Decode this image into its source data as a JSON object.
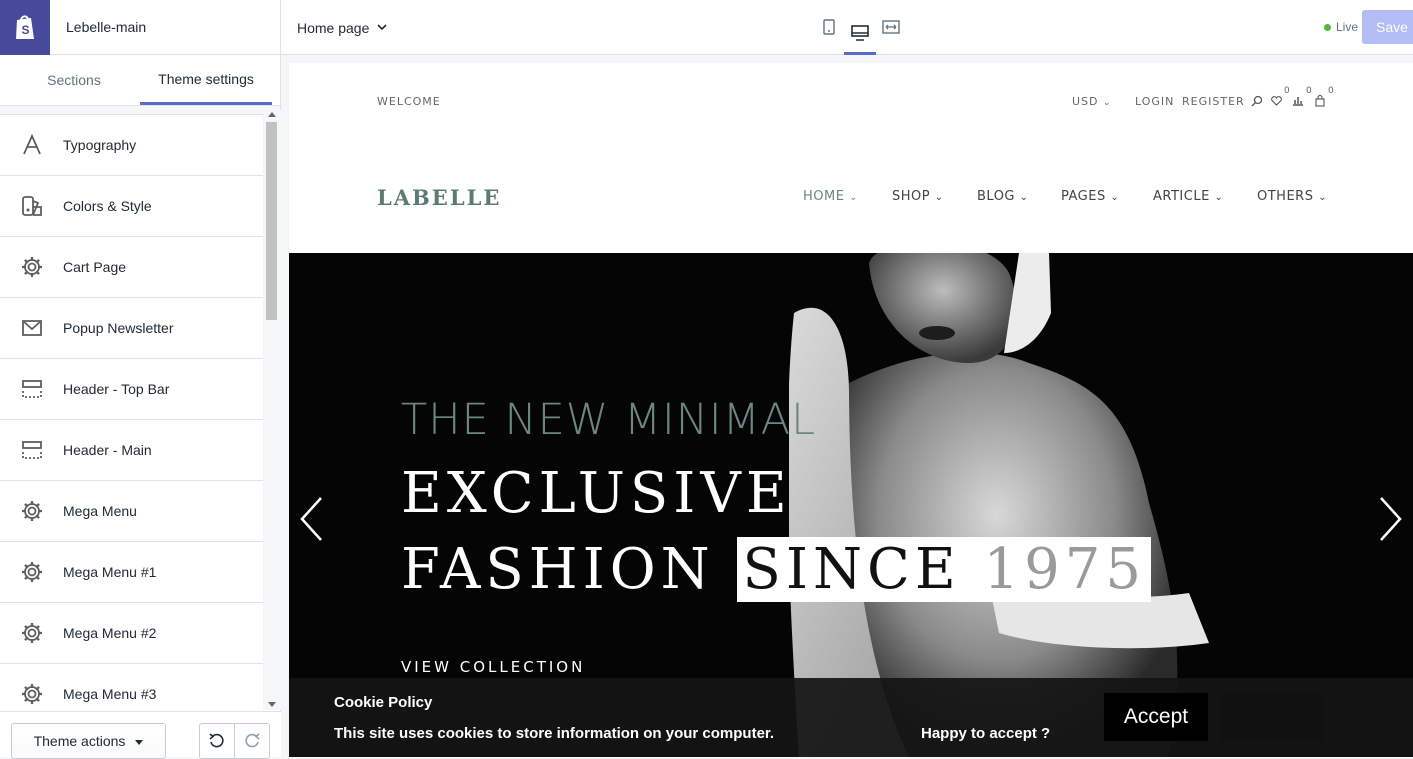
{
  "store": {
    "name": "Lebelle-main"
  },
  "sidebar": {
    "tabs": [
      {
        "label": "Sections"
      },
      {
        "label": "Theme settings"
      }
    ],
    "items": [
      {
        "label": "Typography",
        "icon": "typography-icon"
      },
      {
        "label": "Colors & Style",
        "icon": "colors-style-icon"
      },
      {
        "label": "Cart Page",
        "icon": "gear-icon"
      },
      {
        "label": "Popup Newsletter",
        "icon": "envelope-icon"
      },
      {
        "label": "Header - Top Bar",
        "icon": "header-layout-icon"
      },
      {
        "label": "Header - Main",
        "icon": "header-layout-icon"
      },
      {
        "label": "Mega Menu",
        "icon": "gear-icon"
      },
      {
        "label": "Mega Menu #1",
        "icon": "gear-icon"
      },
      {
        "label": "Mega Menu #2",
        "icon": "gear-icon"
      },
      {
        "label": "Mega Menu #3",
        "icon": "gear-icon"
      }
    ],
    "footer": {
      "theme_actions": "Theme actions"
    }
  },
  "topbar": {
    "page_selector": "Home page",
    "live": "Live",
    "save": "Save"
  },
  "site": {
    "welcome": "WELCOME",
    "currency": "USD",
    "login": "LOGIN",
    "register": "REGISTER",
    "wishlist_count": "0",
    "compare_count": "0",
    "cart_count": "0",
    "brand": "LABELLE",
    "nav": [
      "HOME",
      "SHOP",
      "BLOG",
      "PAGES",
      "ARTICLE",
      "OTHERS"
    ],
    "hero": {
      "subtitle": "THE NEW MINIMAL",
      "title_line1": "EXCLUSIVE",
      "title_line2a": "FASHION",
      "title_line2b": "SINCE",
      "title_line2c": "1975",
      "cta": "VIEW COLLECTION"
    },
    "cookie": {
      "title": "Cookie Policy",
      "text": "This site uses cookies to store information on your computer.",
      "question": "Happy to accept ?",
      "accept": "Accept"
    }
  },
  "colors": {
    "accent": "#5c6ac4",
    "logo_bg": "#47499b",
    "brand": "#5b7a73",
    "live": "#50b83c",
    "save": "#b3bcf5"
  }
}
